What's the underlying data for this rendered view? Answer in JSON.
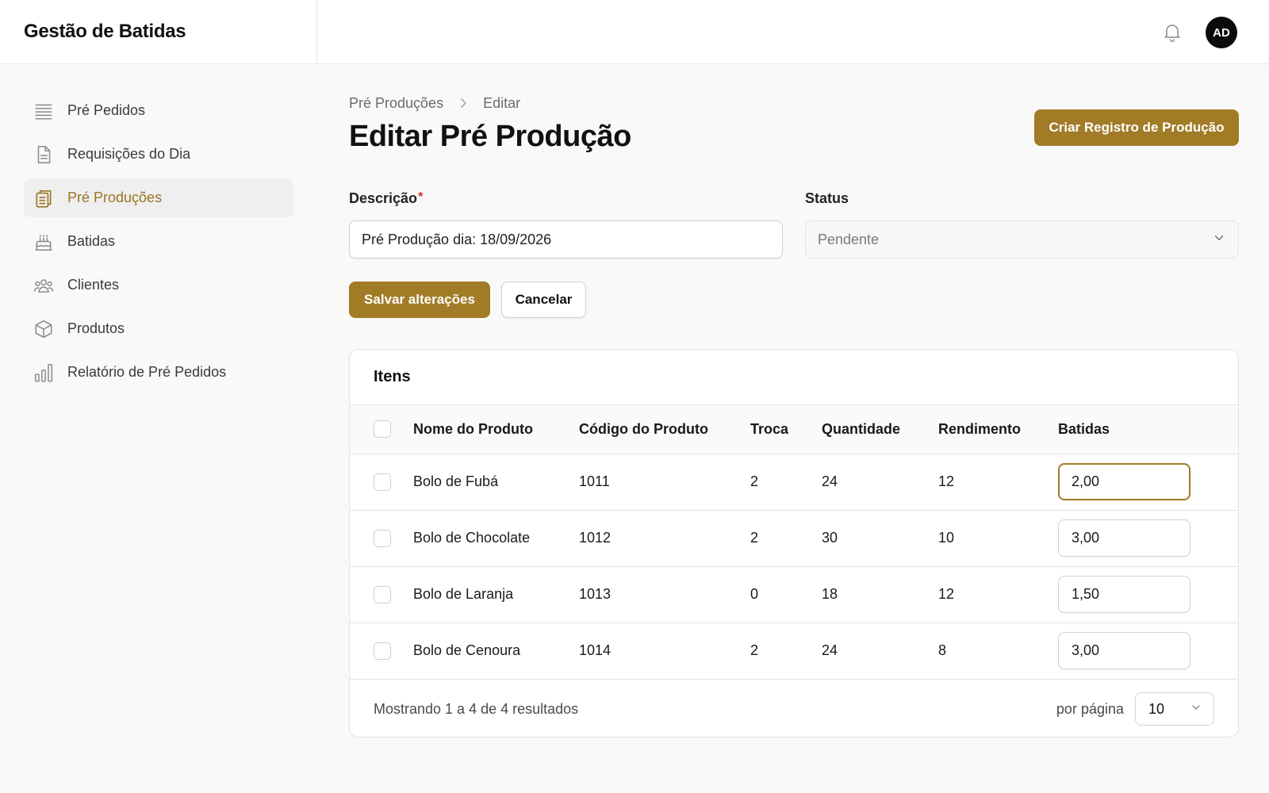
{
  "app": {
    "title": "Gestão de Batidas"
  },
  "header": {
    "avatar_initials": "AD",
    "bell_icon": "bell-icon"
  },
  "sidebar": {
    "items": [
      {
        "label": "Pré Pedidos",
        "icon": "list-icon",
        "active": false
      },
      {
        "label": "Requisições do Dia",
        "icon": "document-icon",
        "active": false
      },
      {
        "label": "Pré Produções",
        "icon": "clipboard-icon",
        "active": true
      },
      {
        "label": "Batidas",
        "icon": "cake-icon",
        "active": false
      },
      {
        "label": "Clientes",
        "icon": "users-icon",
        "active": false
      },
      {
        "label": "Produtos",
        "icon": "cube-icon",
        "active": false
      },
      {
        "label": "Relatório de Pré Pedidos",
        "icon": "bar-chart-icon",
        "active": false
      }
    ]
  },
  "breadcrumb": {
    "parent": "Pré Produções",
    "current": "Editar"
  },
  "page": {
    "title": "Editar Pré Produção",
    "create_button": "Criar Registro de Produção"
  },
  "form": {
    "description_label": "Descrição",
    "required_mark": "*",
    "description_value": "Pré Produção dia: 18/09/2026",
    "status_label": "Status",
    "status_value": "Pendente",
    "save_button": "Salvar alterações",
    "cancel_button": "Cancelar"
  },
  "items": {
    "title": "Itens",
    "columns": [
      "Nome do Produto",
      "Código do Produto",
      "Troca",
      "Quantidade",
      "Rendimento",
      "Batidas"
    ],
    "rows": [
      {
        "name": "Bolo de Fubá",
        "code": "1011",
        "troca": "2",
        "quantidade": "24",
        "rendimento": "12",
        "batidas": "2,00"
      },
      {
        "name": "Bolo de Chocolate",
        "code": "1012",
        "troca": "2",
        "quantidade": "30",
        "rendimento": "10",
        "batidas": "3,00"
      },
      {
        "name": "Bolo de Laranja",
        "code": "1013",
        "troca": "0",
        "quantidade": "18",
        "rendimento": "12",
        "batidas": "1,50"
      },
      {
        "name": "Bolo de Cenoura",
        "code": "1014",
        "troca": "2",
        "quantidade": "24",
        "rendimento": "8",
        "batidas": "3,00"
      }
    ],
    "results_text": "Mostrando 1 a 4 de 4 resultados",
    "per_page_label": "por página",
    "per_page_value": "10"
  },
  "colors": {
    "accent": "#a27b27",
    "active_text": "#9a7422",
    "required": "#d62a2a"
  }
}
